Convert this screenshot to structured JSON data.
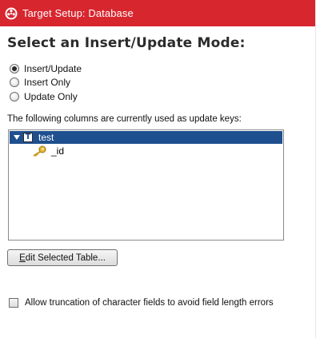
{
  "window": {
    "title": "Target Setup: Database",
    "accent_color": "#d8262f"
  },
  "heading": "Select an Insert/Update Mode:",
  "modes": [
    {
      "label": "Insert/Update",
      "checked": true
    },
    {
      "label": "Insert Only",
      "checked": false
    },
    {
      "label": "Update Only",
      "checked": false
    }
  ],
  "keys_label": "The following columns are currently used as update keys:",
  "tree": {
    "table": {
      "name": "test",
      "icon": "table-icon",
      "icon_glyph": "T",
      "expanded": true,
      "selected": true
    },
    "columns": [
      {
        "name": "_id",
        "icon": "key-icon"
      }
    ]
  },
  "edit_button": {
    "mnemonic": "E",
    "rest": "dit Selected Table..."
  },
  "truncation_checkbox": {
    "label": "Allow truncation of character fields to avoid field length errors",
    "checked": false
  }
}
